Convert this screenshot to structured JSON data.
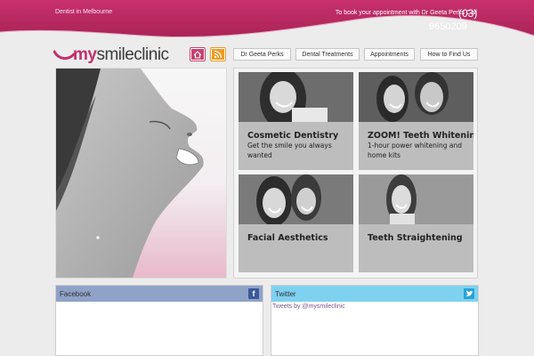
{
  "header": {
    "tagline": "Dentist in Melbourne",
    "booking_text": "To book your appointment with Dr Geeta Perks Call",
    "phone_area": "(03)",
    "phone_number": "9650209",
    "brand_color": "#c1306b"
  },
  "logo": {
    "part1": "my",
    "part2": "smileclinic"
  },
  "icons": {
    "home": "home-icon",
    "rss": "rss-icon"
  },
  "nav": {
    "items": [
      {
        "label": "Dr Geeta Perks"
      },
      {
        "label": "Dental Treatments"
      },
      {
        "label": "Appointments"
      },
      {
        "label": "How to Find Us"
      }
    ]
  },
  "services": [
    {
      "title": "Cosmetic Dentistry",
      "desc": "Get the smile you always wanted"
    },
    {
      "title": "ZOOM! Teeth Whitening",
      "desc": "1-hour power whitening and home kits"
    },
    {
      "title": "Facial Aesthetics",
      "desc": ""
    },
    {
      "title": "Teeth Straightening",
      "desc": ""
    }
  ],
  "social": {
    "facebook_title": "Facebook",
    "facebook_icon": "f",
    "twitter_title": "Twitter",
    "twitter_link": "Tweets by @mysmileclinic",
    "facebook_color": "#8fa2c8",
    "twitter_color": "#7fd1f0"
  }
}
